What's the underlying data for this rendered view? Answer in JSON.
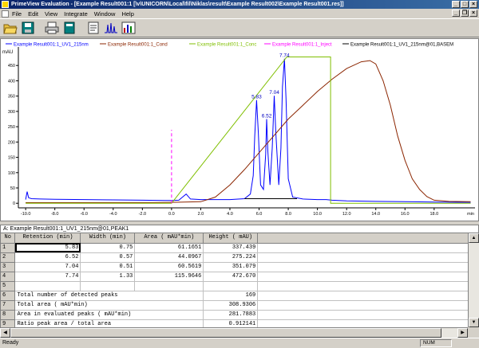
{
  "window": {
    "title": "PrimeView Evaluation - [Example Result001:1   [\\v\\UNICORN\\Local\\fil\\Niklas\\result\\Example Result002\\Example Result001.res]]"
  },
  "menu": {
    "items": [
      "File",
      "Edit",
      "View",
      "Integrate",
      "Window",
      "Help"
    ]
  },
  "toolbar": {
    "icons": [
      "open-folder-icon",
      "save-icon",
      "print-icon",
      "notebook-icon",
      "report-icon",
      "peaks-icon",
      "chart-icon"
    ]
  },
  "legend": [
    {
      "label": "Example Result001:1_UV1_215nm",
      "color": "#0000ff"
    },
    {
      "label": "Example Result001:1_Cond",
      "color": "#8b2500"
    },
    {
      "label": "Example Result001:1_Conc",
      "color": "#7fbf00"
    },
    {
      "label": "Example Result001:1_Inject",
      "color": "#ff00ff"
    },
    {
      "label": "Example Result001:1_UV1_215nm@01,BASEM",
      "color": "#000000"
    }
  ],
  "chart_data": {
    "type": "line",
    "ylabel": "mAU",
    "xlabel": "min",
    "xlim": [
      -10.5,
      20.8
    ],
    "ylim": [
      -15,
      500
    ],
    "x_ticks": [
      -10,
      -8,
      -6,
      -4,
      -2,
      0,
      2,
      4,
      6,
      8,
      10,
      12,
      14,
      16,
      18
    ],
    "x_tick_labels": [
      "-10.0",
      "-8.0",
      "-6.0",
      "-4.0",
      "-2.0",
      "0.0",
      "2.0",
      "4.0",
      "6.0",
      "8.0",
      "10.0",
      "12.0",
      "14.0",
      "16.0",
      "18.0"
    ],
    "y_ticks": [
      0,
      50,
      100,
      150,
      200,
      250,
      300,
      350,
      400,
      450
    ],
    "peak_labels": [
      {
        "x": 5.83,
        "y": 337.4,
        "text": "5.83"
      },
      {
        "x": 6.52,
        "y": 275.2,
        "text": "6.52"
      },
      {
        "x": 7.04,
        "y": 351.1,
        "text": "7.04"
      },
      {
        "x": 7.74,
        "y": 472.7,
        "text": "7.74"
      }
    ],
    "series": [
      {
        "name": "Example Result001:1_UV1_215nm",
        "color": "#0000ff",
        "x": [
          -10.0,
          -9.9,
          -9.8,
          -9.6,
          -9.0,
          -8.0,
          -6.0,
          -4.0,
          -2.0,
          -0.5,
          0.0,
          0.5,
          0.8,
          1.0,
          1.3,
          2.0,
          3.0,
          4.0,
          5.0,
          5.4,
          5.6,
          5.7,
          5.83,
          5.95,
          6.1,
          6.3,
          6.45,
          6.52,
          6.6,
          6.75,
          6.9,
          7.04,
          7.15,
          7.35,
          7.5,
          7.6,
          7.74,
          7.85,
          8.0,
          8.3,
          9.0,
          10.0,
          10.6,
          11.0,
          12.0,
          14.0,
          16.0,
          18.0,
          20.5
        ],
        "y": [
          12,
          38,
          18,
          15,
          14,
          13,
          12,
          11,
          10,
          9,
          9,
          10,
          22,
          30,
          14,
          12,
          12,
          12,
          15,
          30,
          90,
          220,
          337,
          230,
          60,
          45,
          160,
          275,
          170,
          60,
          180,
          351,
          230,
          60,
          180,
          380,
          472,
          340,
          80,
          20,
          14,
          12,
          12,
          10,
          8,
          6,
          5,
          4,
          3
        ]
      },
      {
        "name": "Example Result001:1_Cond",
        "color": "#8b2500",
        "x": [
          -10.0,
          -6.0,
          -2.0,
          0.0,
          2.0,
          3.0,
          4.0,
          5.0,
          6.0,
          7.0,
          8.0,
          9.0,
          10.0,
          11.0,
          12.0,
          13.0,
          13.6,
          14.0,
          14.5,
          15.0,
          15.5,
          16.0,
          16.5,
          17.0,
          17.5,
          18.0,
          19.0,
          20.5
        ],
        "y": [
          2,
          2,
          2,
          3,
          5,
          20,
          60,
          110,
          165,
          220,
          275,
          320,
          365,
          405,
          440,
          462,
          466,
          455,
          400,
          320,
          220,
          140,
          80,
          45,
          22,
          10,
          6,
          5
        ]
      },
      {
        "name": "Example Result001:1_Conc",
        "color": "#7fbf00",
        "x": [
          -10.0,
          0.0,
          7.9,
          7.9,
          10.9,
          10.9,
          20.5
        ],
        "y": [
          0,
          0,
          478,
          478,
          478,
          0,
          0
        ]
      },
      {
        "name": "Example Result001:1_Inject",
        "color": "#ff00ff",
        "x": [
          0.0,
          0.0
        ],
        "y": [
          0,
          240
        ]
      },
      {
        "name": "Example Result001:1_UV1_215nm@01,BASEM",
        "color": "#000000",
        "x": [
          5.0,
          8.6
        ],
        "y": [
          15,
          15
        ]
      }
    ]
  },
  "panel": {
    "title": "A: Example Result001:1_UV1_215nm@01,PEAK1"
  },
  "table": {
    "headers": [
      "No",
      "Retention (min)",
      "Width (min)",
      "Area ( mAU*min)",
      "Height ( mAU)"
    ],
    "rows": [
      [
        "1",
        "5.83",
        "0.75",
        "61.1651",
        "337.439"
      ],
      [
        "2",
        "6.52",
        "0.57",
        "44.0967",
        "275.224"
      ],
      [
        "3",
        "7.04",
        "0.51",
        "60.5619",
        "351.079"
      ],
      [
        "4",
        "7.74",
        "1.33",
        "115.9646",
        "472.670"
      ],
      [
        "5",
        "",
        "",
        "",
        ""
      ]
    ],
    "summary": [
      [
        "6",
        "Total number of detected peaks",
        "169"
      ],
      [
        "7",
        "Total area ( mAU*min)",
        "308.9306"
      ],
      [
        "8",
        "Area in evaluated peaks ( mAU*min)",
        "281.7883"
      ],
      [
        "9",
        "Ratio peak area / total area",
        "0.912141"
      ]
    ]
  },
  "status": {
    "text": "Ready",
    "num": "NUM"
  }
}
